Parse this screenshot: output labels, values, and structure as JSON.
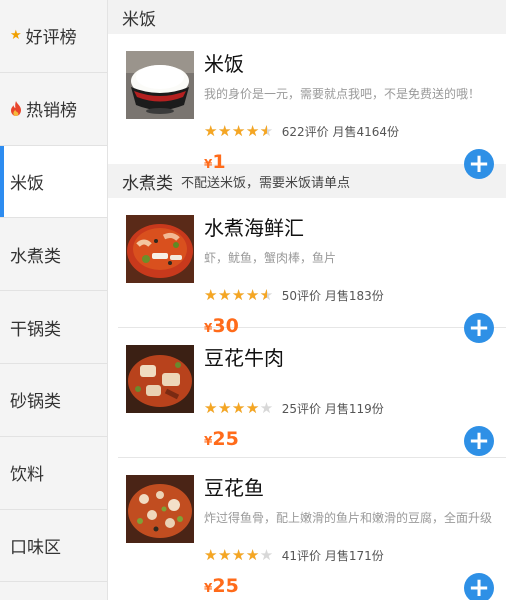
{
  "sidebar": {
    "items": [
      {
        "label": "好评榜",
        "icon": "star-icon"
      },
      {
        "label": "热销榜",
        "icon": "flame-icon"
      },
      {
        "label": "米饭",
        "active": true
      },
      {
        "label": "水煮类"
      },
      {
        "label": "干锅类"
      },
      {
        "label": "砂锅类"
      },
      {
        "label": "饮料"
      },
      {
        "label": "口味区"
      }
    ]
  },
  "sections": [
    {
      "title": "米饭",
      "note": "",
      "items": [
        {
          "name": "米饭",
          "desc": "我的身价是一元，需要就点我吧，不是免费送的哦！",
          "rating": 4.5,
          "reviews": "622评价 月售4164份",
          "currency": "¥",
          "price": "1",
          "image": "rice-bowl-image"
        }
      ]
    },
    {
      "title": "水煮类",
      "note": "不配送米饭，需要米饭请单点",
      "items": [
        {
          "name": "水煮海鲜汇",
          "desc": "虾，鱿鱼，蟹肉棒，鱼片",
          "rating": 4.5,
          "reviews": "50评价 月售183份",
          "currency": "¥",
          "price": "30",
          "image": "seafood-stew-image"
        },
        {
          "name": "豆花牛肉",
          "desc": "",
          "rating": 4,
          "reviews": "25评价 月售119份",
          "currency": "¥",
          "price": "25",
          "image": "tofu-beef-image"
        },
        {
          "name": "豆花鱼",
          "desc": "炸过得鱼骨，配上嫩滑的鱼片和嫩滑的豆腐，全面升级",
          "rating": 4,
          "reviews": "41评价 月售171份",
          "currency": "¥",
          "price": "25",
          "image": "tofu-fish-image"
        }
      ]
    }
  ],
  "colors": {
    "accent": "#2e90e6",
    "price": "#ff6b1a",
    "star": "#f5a623",
    "sidebar_active_bar": "#2d8cf0"
  }
}
